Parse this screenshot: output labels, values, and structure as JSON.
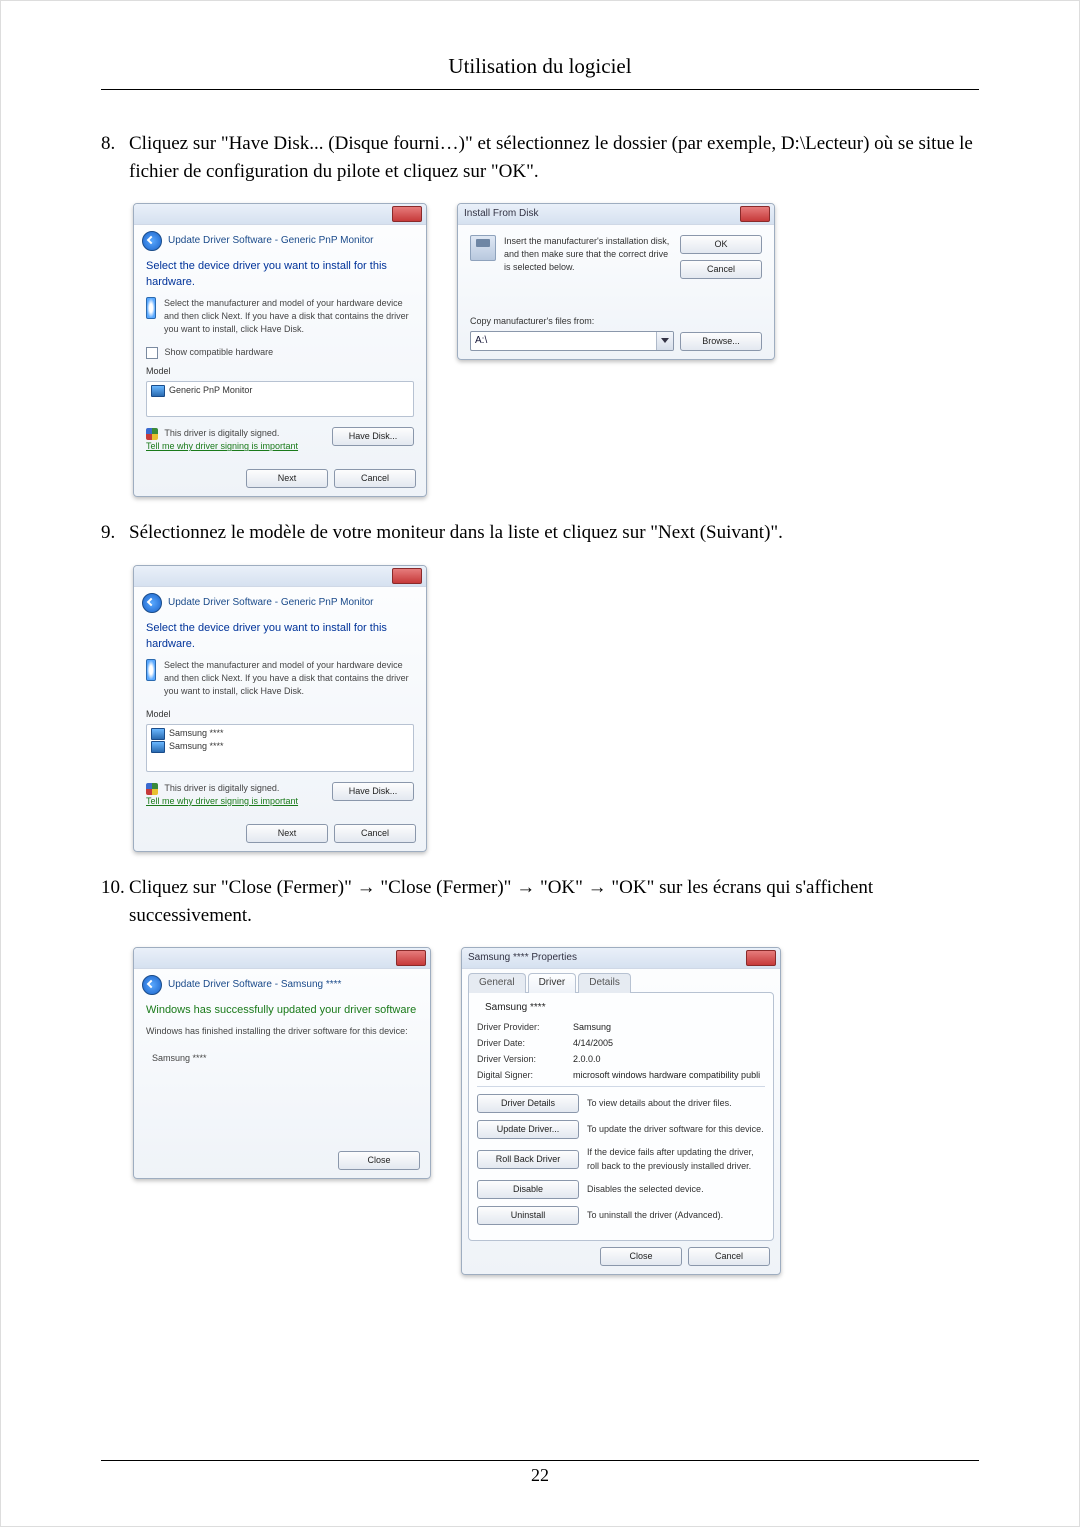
{
  "page": {
    "title": "Utilisation du logiciel",
    "number": "22"
  },
  "steps": [
    {
      "num": "8.",
      "text": "Cliquez sur \"Have Disk... (Disque fourni…)\" et sélectionnez le dossier (par exemple, D:\\Lecteur) où se situe le fichier de configuration du pilote et cliquez sur \"OK\"."
    },
    {
      "num": "9.",
      "text": "Sélectionnez le modèle de votre moniteur dans la liste et cliquez sur \"Next (Suivant)\"."
    },
    {
      "num": "10.",
      "text": "Cliquez sur \"Close (Fermer)\" → \"Close (Fermer)\" → \"OK\" → \"OK\" sur les écrans qui s'affichent successivement."
    }
  ],
  "dlgA": {
    "breadcrumb": "Update Driver Software - Generic PnP Monitor",
    "heading": "Select the device driver you want to install for this hardware.",
    "hint": "Select the manufacturer and model of your hardware device and then click Next. If you have a disk that contains the driver you want to install, click Have Disk.",
    "chk_label": "Show compatible hardware",
    "list_header": "Model",
    "list_item": "Generic PnP Monitor",
    "signed": "This driver is digitally signed.",
    "tell_me": "Tell me why driver signing is important",
    "have_disk": "Have Disk...",
    "next": "Next",
    "cancel": "Cancel"
  },
  "dlgB": {
    "title": "Install From Disk",
    "instr": "Insert the manufacturer's installation disk, and then make sure that the correct drive is selected below.",
    "ok": "OK",
    "cancel": "Cancel",
    "copy_label": "Copy manufacturer's files from:",
    "drive_value": "A:\\",
    "browse": "Browse..."
  },
  "dlgC": {
    "breadcrumb": "Update Driver Software - Generic PnP Monitor",
    "heading": "Select the device driver you want to install for this hardware.",
    "hint": "Select the manufacturer and model of your hardware device and then click Next. If you have a disk that contains the driver you want to install, click Have Disk.",
    "list_header": "Model",
    "list_item1": "Samsung ****",
    "list_item2": "Samsung ****",
    "signed": "This driver is digitally signed.",
    "tell_me": "Tell me why driver signing is important",
    "have_disk": "Have Disk...",
    "next": "Next",
    "cancel": "Cancel"
  },
  "dlgD": {
    "breadcrumb": "Update Driver Software - Samsung ****",
    "heading": "Windows has successfully updated your driver software",
    "sub": "Windows has finished installing the driver software for this device:",
    "device": "Samsung ****",
    "close": "Close"
  },
  "dlgE": {
    "title": "Samsung **** Properties",
    "tabs": {
      "general": "General",
      "driver": "Driver",
      "details": "Details"
    },
    "device": "Samsung ****",
    "kv": {
      "provider_k": "Driver Provider:",
      "provider_v": "Samsung",
      "date_k": "Driver Date:",
      "date_v": "4/14/2005",
      "version_k": "Driver Version:",
      "version_v": "2.0.0.0",
      "signer_k": "Digital Signer:",
      "signer_v": "microsoft windows hardware compatibility publi"
    },
    "actions": {
      "details_btn": "Driver Details",
      "details_desc": "To view details about the driver files.",
      "update_btn": "Update Driver...",
      "update_desc": "To update the driver software for this device.",
      "rollback_btn": "Roll Back Driver",
      "rollback_desc": "If the device fails after updating the driver, roll back to the previously installed driver.",
      "disable_btn": "Disable",
      "disable_desc": "Disables the selected device.",
      "uninstall_btn": "Uninstall",
      "uninstall_desc": "To uninstall the driver (Advanced)."
    },
    "close": "Close",
    "cancel": "Cancel"
  }
}
